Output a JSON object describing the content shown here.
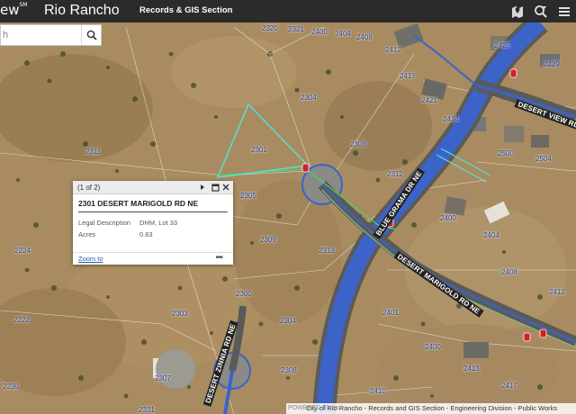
{
  "header": {
    "logo_fragment": "ew",
    "logo_tm": "SM",
    "app_title": "Rio Rancho",
    "subtitle": "Records & GIS Section",
    "tools": [
      "map-pin-tool",
      "search-tool",
      "menu-tool"
    ]
  },
  "search": {
    "value": "h",
    "placeholder": ""
  },
  "popup": {
    "count": "(1 of 2)",
    "title": "2301 DESERT MARIGOLD RD NE",
    "rows": [
      {
        "key": "Legal Description",
        "value": "DHM, Lot 33"
      },
      {
        "key": "Acres",
        "value": "0.63"
      }
    ],
    "zoom_label": "Zoom to",
    "more_label": "•••"
  },
  "streets": {
    "blue_grama": "BLUE GRAMA DR NE",
    "desert_view": "DESERT VIEW RD NE",
    "desert_marigold": "DESERT MARIGOLD RD NE",
    "desert_zinnia": "DESERT ZINNIA RD NE"
  },
  "parcels": {
    "p2320": "2320",
    "p2321": "2321",
    "p2400": "2400",
    "p2404": "2404",
    "p2408": "2408",
    "p2412": "2412",
    "p2425": "2425",
    "p2429": "2429",
    "p2417": "2417",
    "p2421": "2421",
    "p2424": "2424",
    "p2304": "2304",
    "p2308": "2308",
    "p2301": "2301",
    "p2311": "2311",
    "p2312": "2312",
    "p2500": "2500",
    "p2504": "2504",
    "p2305": "2305",
    "p2309": "2309",
    "p2313": "2313",
    "p2400b": "2400",
    "p2404b": "2404",
    "p2408b": "2408",
    "p2224": "2224",
    "p2412b": "2412",
    "p2300": "2300",
    "p2303": "2303",
    "p2304b": "2304",
    "p2401": "2401",
    "p2222": "2222",
    "p2400c": "2400",
    "p2307": "2307",
    "p2308b": "2308",
    "p2413": "2413",
    "p2417b": "2417",
    "p2230": "2230",
    "p2331": "2331",
    "p2410": "2410"
  },
  "attribution": {
    "esri": "POWERED BY esri",
    "text": "City of Rio Rancho - Records and GIS Section - Engineering Division - Public Works"
  },
  "colors": {
    "header_bg": "#2b2b2b",
    "road_blue": "#3c63c8",
    "parcel_line": "#f2f2f2",
    "selection": "#56e0d6",
    "label_blue": "#1f3fa6"
  }
}
